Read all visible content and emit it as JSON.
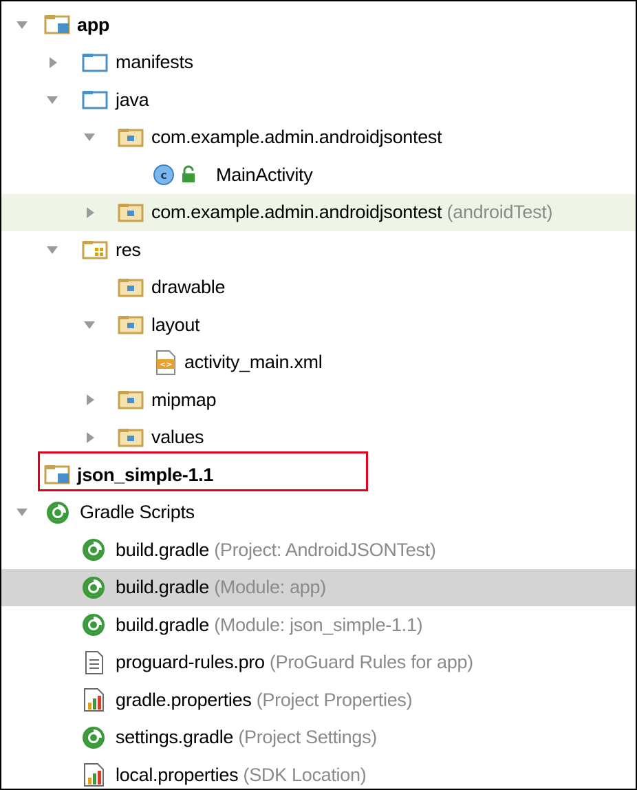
{
  "tree": {
    "root_label": "app",
    "manifests_label": "manifests",
    "java_label": "java",
    "pkg_main_label": "com.example.admin.androidjsontest",
    "main_activity_label": "MainActivity",
    "pkg_test_label": "com.example.admin.androidjsontest",
    "pkg_test_suffix": "(androidTest)",
    "res_label": "res",
    "drawable_label": "drawable",
    "layout_label": "layout",
    "activity_main_label": "activity_main.xml",
    "mipmap_label": "mipmap",
    "values_label": "values",
    "json_simple_label": "json_simple-1.1",
    "gradle_scripts_label": "Gradle Scripts",
    "build_gradle_project_label": "build.gradle",
    "build_gradle_project_suffix": "(Project: AndroidJSONTest)",
    "build_gradle_app_label": "build.gradle",
    "build_gradle_app_suffix": "(Module: app)",
    "build_gradle_json_label": "build.gradle",
    "build_gradle_json_suffix": "(Module: json_simple-1.1)",
    "proguard_label": "proguard-rules.pro",
    "proguard_suffix": "(ProGuard Rules for app)",
    "gradle_properties_label": "gradle.properties",
    "gradle_properties_suffix": "(Project Properties)",
    "settings_gradle_label": "settings.gradle",
    "settings_gradle_suffix": "(Project Settings)",
    "local_properties_label": "local.properties",
    "local_properties_suffix": "(SDK Location)"
  },
  "icons": {
    "module_folder": "module-folder-icon",
    "folder": "folder-icon",
    "package": "package-icon",
    "class": "class-icon",
    "res_folder": "resource-folder-icon",
    "xml_file": "xml-file-icon",
    "gradle": "gradle-icon",
    "text_file": "text-file-icon",
    "properties_file": "properties-file-icon"
  },
  "colors": {
    "selected_row_bg": "#d4d4d4",
    "test_row_bg": "#eef5e7",
    "annotation_border": "#e0001b",
    "folder_blue": "#4a90c8",
    "package_gold": "#c8a24c",
    "gradle_green": "#3a9a3a",
    "suffix_gray": "#8a8a8a"
  }
}
